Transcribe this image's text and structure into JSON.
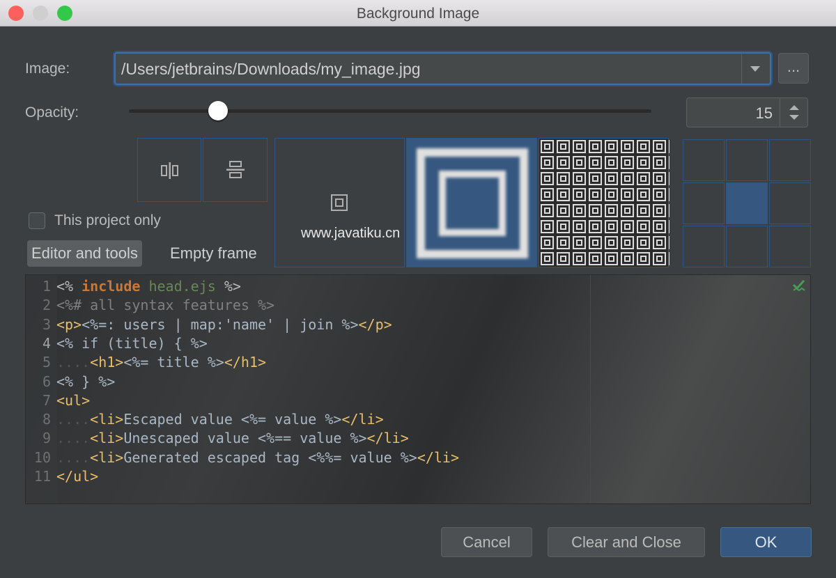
{
  "window": {
    "title": "Background Image"
  },
  "image": {
    "label": "Image:",
    "path": "/Users/jetbrains/Downloads/my_image.jpg",
    "browse_label": "..."
  },
  "opacity": {
    "label": "Opacity:",
    "value": 15,
    "value_text": "15",
    "max": 100
  },
  "fill_options": [
    "tile-horizontal",
    "tile-vertical"
  ],
  "preview_modes": [
    "center",
    "scale (selected)",
    "tile"
  ],
  "anchor": {
    "selected": "center"
  },
  "this_project_only": {
    "label": "This project only",
    "checked": false
  },
  "tabs": [
    {
      "label": "Editor and tools",
      "selected": true
    },
    {
      "label": "Empty frame",
      "selected": false
    }
  ],
  "watermark": "www.javatiku.cn",
  "editor": {
    "lines": [
      [
        [
          "<% ",
          "delim"
        ],
        [
          "include",
          "kw"
        ],
        [
          " ",
          "text"
        ],
        [
          "head.ejs",
          "str"
        ],
        [
          " %>",
          "delim"
        ]
      ],
      [
        [
          "<%# all syntax features %>",
          "cmt"
        ]
      ],
      [
        [
          "<p>",
          "tag"
        ],
        [
          "<%=: users | map:'name' | join %>",
          "text"
        ],
        [
          "</p>",
          "tag"
        ]
      ],
      [
        [
          "<% if (title) { %>",
          "text"
        ]
      ],
      [
        [
          "....",
          "ws"
        ],
        [
          "<h1>",
          "tag"
        ],
        [
          "<%= title %>",
          "text"
        ],
        [
          "</h1>",
          "tag"
        ]
      ],
      [
        [
          "<% } %>",
          "text"
        ]
      ],
      [
        [
          "<ul>",
          "tag"
        ]
      ],
      [
        [
          "....",
          "ws"
        ],
        [
          "<li>",
          "tag"
        ],
        [
          "Escaped value <%= value %>",
          "text"
        ],
        [
          "</li>",
          "tag"
        ]
      ],
      [
        [
          "....",
          "ws"
        ],
        [
          "<li>",
          "tag"
        ],
        [
          "Unescaped value <%== value %>",
          "text"
        ],
        [
          "</li>",
          "tag"
        ]
      ],
      [
        [
          "....",
          "ws"
        ],
        [
          "<li>",
          "tag"
        ],
        [
          "Generated escaped tag <%%= value %>",
          "text"
        ],
        [
          "</li>",
          "tag"
        ]
      ],
      [
        [
          "</ul>",
          "tag"
        ]
      ]
    ]
  },
  "buttons": {
    "cancel": "Cancel",
    "clear": "Clear and Close",
    "ok": "OK"
  },
  "colors": {
    "accent": "#365880",
    "selection": "#2f5583",
    "background": "#3c3f41"
  }
}
